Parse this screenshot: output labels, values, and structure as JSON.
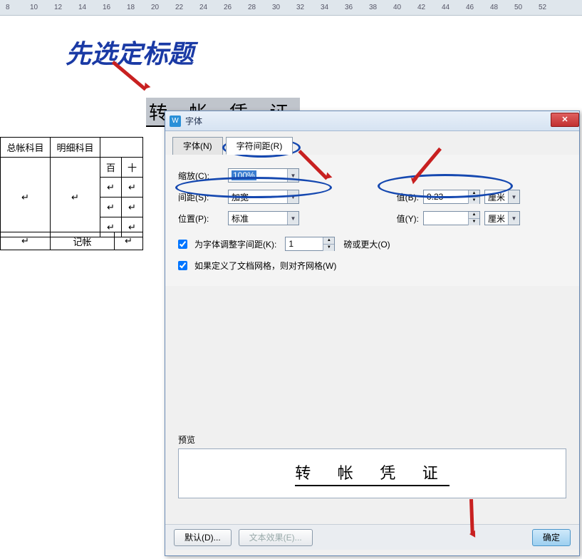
{
  "ruler": {
    "ticks": [
      "8",
      "10",
      "12",
      "14",
      "16",
      "18",
      "20",
      "22",
      "24",
      "26",
      "28",
      "30",
      "32",
      "34",
      "36",
      "38",
      "40",
      "42",
      "44",
      "46",
      "48",
      "50",
      "52"
    ]
  },
  "doc": {
    "annotation": "先选定标题",
    "title": "转 帐 凭 证",
    "table": {
      "headers": [
        "总帐科目",
        "明细科目",
        "百",
        "十"
      ],
      "footer_label": "记帐"
    }
  },
  "dialog": {
    "title": "字体",
    "close": "✕",
    "tabs": {
      "font": "字体(N)",
      "spacing": "字符间距(R)"
    },
    "fields": {
      "scale_label": "缩放(C):",
      "scale_value": "100%",
      "spacing_label": "间距(S):",
      "spacing_value": "加宽",
      "position_label": "位置(P):",
      "position_value": "标准",
      "value_b_label": "值(B):",
      "value_b_value": "0.23",
      "unit_cm": "厘米",
      "value_y_label": "值(Y):",
      "value_y_value": "",
      "kerning_label": "为字体调整字间距(K):",
      "kerning_value": "1",
      "kerning_unit": "磅或更大(O)",
      "snap_grid_label": "如果定义了文档网格，则对齐网格(W)"
    },
    "preview": {
      "label": "预览",
      "text": "转 帐 凭 证"
    },
    "buttons": {
      "default": "默认(D)...",
      "effects": "文本效果(E)...",
      "ok": "确定"
    }
  }
}
